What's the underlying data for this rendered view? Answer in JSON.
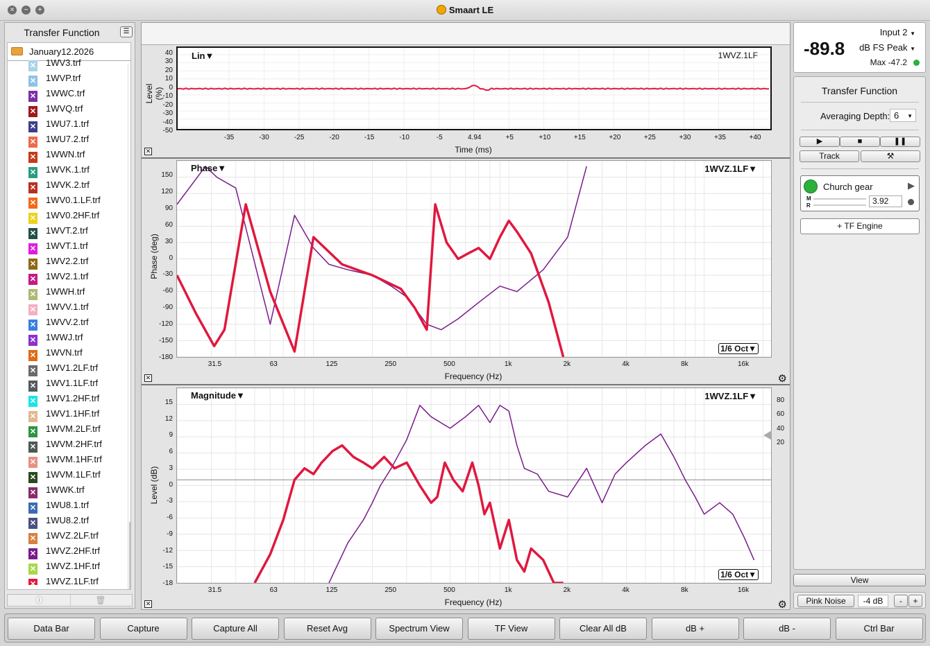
{
  "app": {
    "title": "Smaart LE"
  },
  "left_panel": {
    "title": "Transfer Function",
    "folder": "January12.2026",
    "files": [
      {
        "name": "1WV3.trf",
        "color": "#a9d3e8"
      },
      {
        "name": "1WVP.trf",
        "color": "#8ec2e8"
      },
      {
        "name": "1WWC.trf",
        "color": "#7b2fa6"
      },
      {
        "name": "1WVQ.trf",
        "color": "#a0181e"
      },
      {
        "name": "1WU7.1.trf",
        "color": "#3e3d8a"
      },
      {
        "name": "1WU7.2.trf",
        "color": "#ee6a4a"
      },
      {
        "name": "1WWN.trf",
        "color": "#c43a1c"
      },
      {
        "name": "1WVK.1.trf",
        "color": "#2a9d80"
      },
      {
        "name": "1WVK.2.trf",
        "color": "#b8311e"
      },
      {
        "name": "1WV0.1.LF.trf",
        "color": "#f26a1a"
      },
      {
        "name": "1WV0.2HF.trf",
        "color": "#ecd21a"
      },
      {
        "name": "1WVT.2.trf",
        "color": "#24504a"
      },
      {
        "name": "1WVT.1.trf",
        "color": "#e01ae0"
      },
      {
        "name": "1WV2.2.trf",
        "color": "#8f6a10"
      },
      {
        "name": "1WV2.1.trf",
        "color": "#c21a86"
      },
      {
        "name": "1WWH.trf",
        "color": "#b0b874"
      },
      {
        "name": "1WVV.1.trf",
        "color": "#f4b0c4"
      },
      {
        "name": "1WVV.2.trf",
        "color": "#3a7ee0"
      },
      {
        "name": "1WWJ.trf",
        "color": "#8a32d0"
      },
      {
        "name": "1WVN.trf",
        "color": "#e06a18"
      },
      {
        "name": "1WV1.2LF.trf",
        "color": "#6a6a6a"
      },
      {
        "name": "1WV1.1LF.trf",
        "color": "#555a60"
      },
      {
        "name": "1WV1.2HF.trf",
        "color": "#1ae4e8"
      },
      {
        "name": "1WV1.1HF.trf",
        "color": "#e0b890"
      },
      {
        "name": "1WVM.2LF.trf",
        "color": "#2e9440"
      },
      {
        "name": "1WVM.2HF.trf",
        "color": "#4a5a50"
      },
      {
        "name": "1WVM.1HF.trf",
        "color": "#e89080"
      },
      {
        "name": "1WVM.1LF.trf",
        "color": "#2a4a1e"
      },
      {
        "name": "1WWK.trf",
        "color": "#8a2a6a"
      },
      {
        "name": "1WU8.1.trf",
        "color": "#3a6ab4"
      },
      {
        "name": "1WU8.2.trf",
        "color": "#4a5080"
      },
      {
        "name": "1WVZ.2LF.trf",
        "color": "#d88040"
      },
      {
        "name": "1WVZ.2HF.trf",
        "color": "#7a1a8c"
      },
      {
        "name": "1WVZ.1HF.trf",
        "color": "#a8d848"
      },
      {
        "name": "1WVZ.1LF.trf",
        "color": "#e01a3c"
      }
    ]
  },
  "impulse_plot": {
    "title": "Lin▼",
    "trace_label": "1WVZ.1LF",
    "ylabel": "Level (%)",
    "xlabel": "Time (ms)",
    "y_ticks": [
      "40",
      "30",
      "20",
      "10",
      "0",
      "-10",
      "-20",
      "-30",
      "-40",
      "-50"
    ],
    "x_ticks": [
      "-35",
      "-30",
      "-25",
      "-20",
      "-15",
      "-10",
      "-5",
      "4.94",
      "+5",
      "+10",
      "+15",
      "+20",
      "+25",
      "+30",
      "+35",
      "+40"
    ]
  },
  "phase_plot": {
    "title": "Phase▼",
    "trace_label": "1WVZ.1LF▼",
    "ylabel": "Phase (deg)",
    "xlabel": "Frequency (Hz)",
    "y_ticks": [
      "150",
      "120",
      "90",
      "60",
      "30",
      "0",
      "-30",
      "-60",
      "-90",
      "-120",
      "-150",
      "-180"
    ],
    "x_ticks": [
      "31.5",
      "63",
      "125",
      "250",
      "500",
      "1k",
      "2k",
      "4k",
      "8k",
      "16k"
    ],
    "smoothing": "1/6 Oct▼"
  },
  "magnitude_plot": {
    "title": "Magnitude▼",
    "trace_label": "1WVZ.1LF▼",
    "ylabel": "Level (dB)",
    "xlabel": "Frequency (Hz)",
    "y_ticks": [
      "15",
      "12",
      "9",
      "6",
      "3",
      "0",
      "-3",
      "-6",
      "-9",
      "-12",
      "-15",
      "-18"
    ],
    "right_ticks": [
      "80",
      "60",
      "40",
      "20"
    ],
    "x_ticks": [
      "31.5",
      "63",
      "125",
      "250",
      "500",
      "1k",
      "2k",
      "4k",
      "8k",
      "16k"
    ],
    "smoothing": "1/6 Oct▼"
  },
  "chart_data": [
    {
      "type": "line",
      "title": "Phase",
      "xlabel": "Frequency (Hz)",
      "ylabel": "Phase (deg)",
      "ylim": [
        -180,
        180
      ],
      "x_scale": "log",
      "series": [
        {
          "name": "1WVZ.1LF",
          "color": "#e0183e",
          "x": [
            20,
            25,
            31,
            35,
            45,
            60,
            80,
            100,
            140,
            200,
            280,
            330,
            380,
            420,
            480,
            550,
            620,
            700,
            800,
            900,
            1000,
            1100,
            1300,
            1600,
            1900
          ],
          "y": [
            -30,
            -100,
            -160,
            -130,
            100,
            -60,
            -170,
            40,
            -10,
            -30,
            -55,
            -90,
            -130,
            100,
            30,
            0,
            10,
            20,
            0,
            40,
            70,
            50,
            10,
            -80,
            -180
          ]
        },
        {
          "name": "1WVZ.1HF",
          "color": "#7a1a8c",
          "x": [
            20,
            28,
            32,
            40,
            60,
            80,
            100,
            120,
            150,
            200,
            250,
            300,
            380,
            450,
            550,
            700,
            900,
            1100,
            1500,
            2000,
            2500
          ],
          "y": [
            100,
            170,
            150,
            130,
            -120,
            80,
            20,
            -10,
            -20,
            -30,
            -50,
            -70,
            -120,
            -130,
            -110,
            -80,
            -50,
            -60,
            -20,
            40,
            170
          ]
        }
      ]
    },
    {
      "type": "line",
      "title": "Magnitude",
      "xlabel": "Frequency (Hz)",
      "ylabel": "Level (dB)",
      "ylim": [
        -18,
        16
      ],
      "x_scale": "log",
      "series": [
        {
          "name": "1WVZ.1LF",
          "color": "#e0183e",
          "x": [
            50,
            60,
            70,
            80,
            90,
            100,
            110,
            125,
            140,
            160,
            180,
            200,
            230,
            260,
            300,
            350,
            400,
            430,
            470,
            520,
            580,
            650,
            700,
            750,
            800,
            900,
            1000,
            1100,
            1200,
            1300,
            1500,
            1700,
            1900
          ],
          "y": [
            -18,
            -13,
            -7,
            0,
            2,
            1,
            3,
            5,
            6,
            4,
            3,
            2,
            4,
            2,
            3,
            -1,
            -4,
            -3,
            3,
            0,
            -2,
            3,
            -1,
            -6,
            -4,
            -12,
            -7,
            -14,
            -16,
            -12,
            -14,
            -18,
            -18
          ]
        },
        {
          "name": "1WVZ.1HF",
          "color": "#7a1a8c",
          "x": [
            120,
            150,
            180,
            200,
            220,
            250,
            300,
            350,
            400,
            500,
            600,
            700,
            800,
            900,
            1000,
            1100,
            1200,
            1400,
            1600,
            2000,
            2500,
            3000,
            3500,
            4000,
            5000,
            6000,
            7000,
            8000,
            9000,
            10000,
            12000,
            14000,
            16000,
            18000
          ],
          "y": [
            -18,
            -11,
            -7,
            -4,
            -1,
            2,
            7,
            13,
            11,
            9,
            11,
            13,
            10,
            13,
            12,
            6,
            2,
            1,
            -2,
            -3,
            2,
            -4,
            1,
            3,
            6,
            8,
            4,
            0,
            -3,
            -6,
            -4,
            -6,
            -10,
            -14
          ]
        }
      ]
    }
  ],
  "right_panel": {
    "meter": {
      "value": "-89.8",
      "input": "Input 2",
      "mode": "dB FS Peak",
      "max": "Max -47.2"
    },
    "tf_title": "Transfer Function",
    "averaging_label": "Averaging Depth:",
    "averaging_value": "6",
    "track_label": "Track",
    "engine": {
      "name": "Church gear",
      "m_label": "M",
      "r_label": "R",
      "delay": "3.92"
    },
    "add_engine": "+ TF Engine",
    "view": "View",
    "pink_noise": "Pink Noise",
    "pink_level": "-4 dB",
    "minus": "-",
    "plus": "+"
  },
  "bottom_bar": [
    "Data Bar",
    "Capture",
    "Capture All",
    "Reset Avg",
    "Spectrum View",
    "TF View",
    "Clear All dB",
    "dB +",
    "dB -",
    "Ctrl Bar"
  ]
}
